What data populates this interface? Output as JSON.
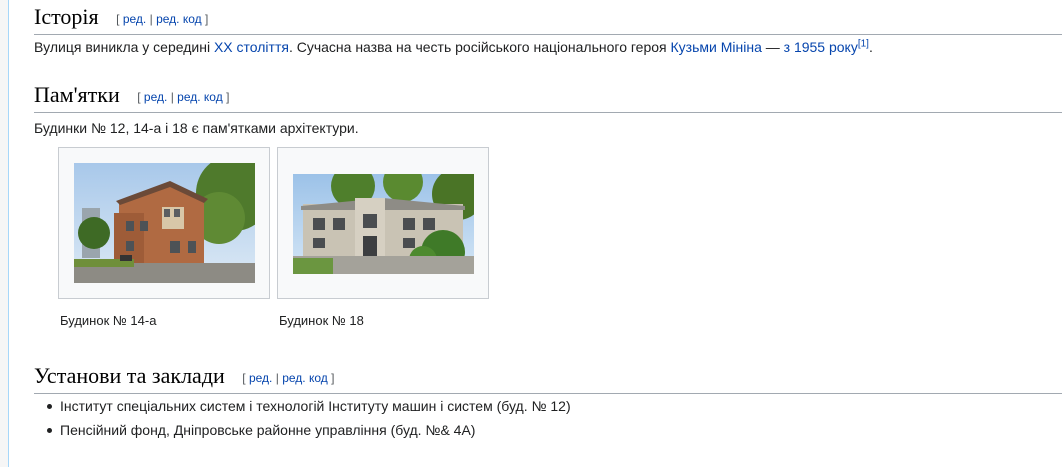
{
  "edit_labels": {
    "open": "[",
    "edit": "ред.",
    "sep": "|",
    "edit_code": "ред. код",
    "close": "]"
  },
  "history": {
    "heading": "Історія",
    "p_start": "Вулиця виникла у середині ",
    "link_century": "XX століття",
    "p_mid": ". Сучасна назва на честь російського національного героя ",
    "link_hero": "Кузьми Мініна",
    "p_dash": " — ",
    "link_year": "з 1955 року",
    "ref": "[1]",
    "p_end": "."
  },
  "monuments": {
    "heading": "Пам'ятки",
    "text": "Будинки № 12, 14-а і 18 є пам'ятками архітектури.",
    "gallery": [
      {
        "caption": "Будинок № 14-а"
      },
      {
        "caption": "Будинок № 18"
      }
    ]
  },
  "institutions": {
    "heading": "Установи та заклади",
    "items": [
      "Інститут спеціальних систем і технологій Інституту машин і систем (буд. № 12)",
      "Пенсійний фонд, Дніпровське районне управління (буд. №& 4А)"
    ]
  },
  "colors": {
    "link": "#0645ad",
    "text": "#202122",
    "border": "#a2a9b1"
  }
}
